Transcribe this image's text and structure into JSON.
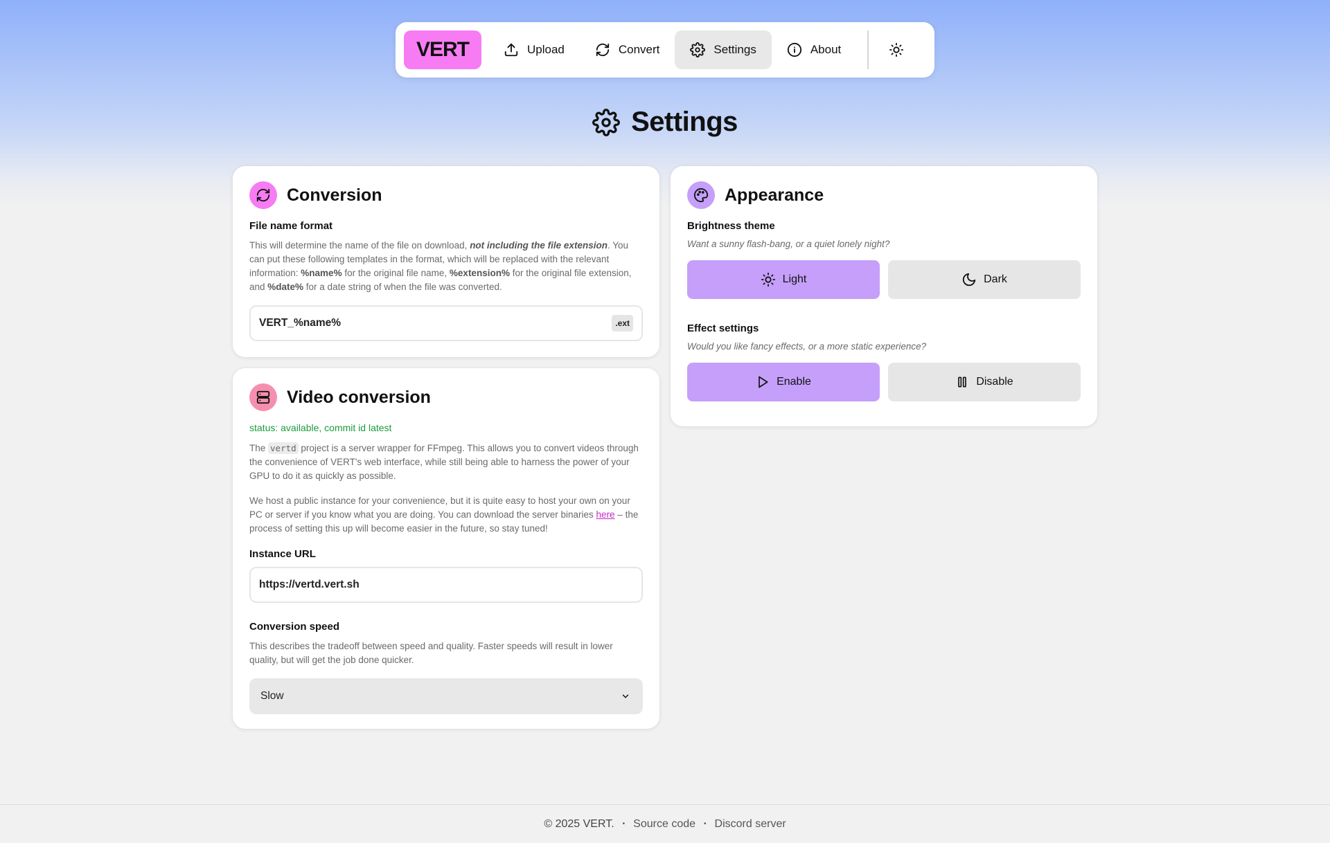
{
  "nav": {
    "logo": "VERT",
    "items": [
      {
        "label": "Upload",
        "icon": "upload-icon"
      },
      {
        "label": "Convert",
        "icon": "refresh-icon"
      },
      {
        "label": "Settings",
        "icon": "gear-icon",
        "active": true
      },
      {
        "label": "About",
        "icon": "info-icon"
      }
    ],
    "theme_icon": "sun-icon"
  },
  "page": {
    "title": "Settings",
    "icon": "gear-icon"
  },
  "conversion": {
    "title": "Conversion",
    "file_name_label": "File name format",
    "desc_1": "This will determine the name of the file on download, ",
    "desc_em": "not including the file extension",
    "desc_2": ". You can put these following templates in the format, which will be replaced with the relevant information: ",
    "tpl_name": "%name%",
    "desc_3": " for the original file name, ",
    "tpl_ext": "%extension%",
    "desc_4": " for the original file extension, and ",
    "tpl_date": "%date%",
    "desc_5": " for a date string of when the file was converted.",
    "file_name_value": "VERT_%name%",
    "ext_badge": ".ext"
  },
  "video": {
    "title": "Video conversion",
    "status": "status: available, commit id latest",
    "p1_a": "The ",
    "p1_code": "vertd",
    "p1_b": " project is a server wrapper for FFmpeg. This allows you to convert videos through the convenience of VERT's web interface, while still being able to harness the power of your GPU to do it as quickly as possible.",
    "p2_a": "We host a public instance for your convenience, but it is quite easy to host your own on your PC or server if you know what you are doing. You can download the server binaries ",
    "p2_link": "here",
    "p2_b": " – the process of setting this up will become easier in the future, so stay tuned!",
    "instance_label": "Instance URL",
    "instance_value": "https://vertd.vert.sh",
    "speed_label": "Conversion speed",
    "speed_desc": "This describes the tradeoff between speed and quality. Faster speeds will result in lower quality, but will get the job done quicker.",
    "speed_value": "Slow"
  },
  "appearance": {
    "title": "Appearance",
    "brightness_label": "Brightness theme",
    "brightness_desc": "Want a sunny flash-bang, or a quiet lonely night?",
    "light": "Light",
    "dark": "Dark",
    "effects_label": "Effect settings",
    "effects_desc": "Would you like fancy effects, or a more static experience?",
    "enable": "Enable",
    "disable": "Disable"
  },
  "footer": {
    "copyright": "© 2025 VERT.",
    "sep": "•",
    "source": "Source code",
    "discord": "Discord server"
  },
  "colors": {
    "brand_pink": "#f77cf3",
    "accent_purple": "#c59ffa",
    "status_green": "#1c9b3e",
    "link": "#c42ac4"
  }
}
